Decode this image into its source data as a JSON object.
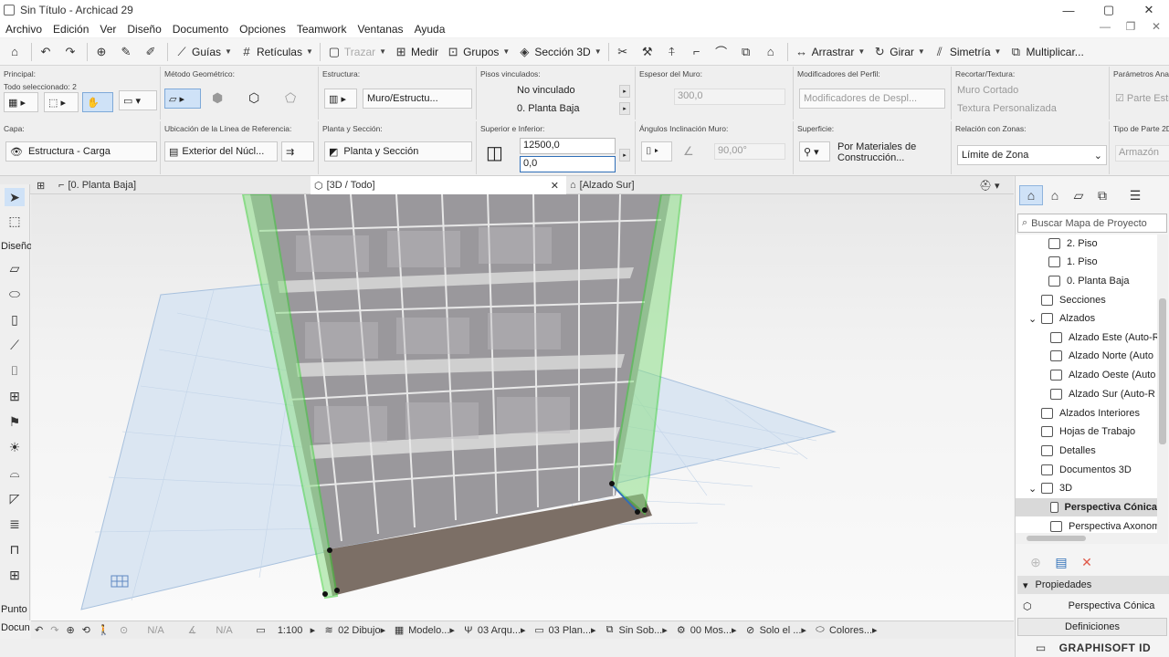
{
  "window": {
    "title": "Sin Título - Archicad 29",
    "min": "—",
    "max": "▢",
    "close": "✕"
  },
  "menu": {
    "items": [
      "Archivo",
      "Edición",
      "Ver",
      "Diseño",
      "Documento",
      "Opciones",
      "Teamwork",
      "Ventanas",
      "Ayuda"
    ]
  },
  "toolbar": {
    "guias": "Guías",
    "reticulas": "Retículas",
    "trazar": "Trazar",
    "medir": "Medir",
    "grupos": "Grupos",
    "seccion3d": "Sección 3D",
    "arrastrar": "Arrastrar",
    "girar": "Girar",
    "simetria": "Simetría",
    "multiplicar": "Multiplicar..."
  },
  "info": {
    "principal_label": "Principal:",
    "todo_sel": "Todo seleccionado: 2",
    "metodo_label": "Método Geométrico:",
    "estructura_label": "Estructura:",
    "estructura_value": "Muro/Estructu...",
    "pisos_label": "Pisos vinculados:",
    "no_vinculado": "No vinculado",
    "planta_baja": "0. Planta Baja",
    "espesor_label": "Espesor del Muro:",
    "espesor_value": "300,0",
    "modificadores_label": "Modificadores del Perfil:",
    "modificadores_value": "Modificadores de Despl...",
    "recortar_label": "Recortar/Textura:",
    "muro_cortado": "Muro Cortado",
    "textura": "Textura Personalizada",
    "param_label": "Parámetros Ana",
    "parte_est": "Parte Estr",
    "capa_label": "Capa:",
    "capa_value": "Estructura - Carga",
    "ubicacion_label": "Ubicación de la Línea de Referencia:",
    "ubicacion_value": "Exterior del Núcl...",
    "planta_label": "Planta y Sección:",
    "planta_value": "Planta y Sección",
    "superior_label": "Superior e Inferior:",
    "superior_value": "12500,0",
    "inferior_value": "0,0",
    "angulos_label": "Ángulos Inclinación Muro:",
    "angulo_value": "90,00°",
    "superficie_label": "Superficie:",
    "superficie_value": "Por Materiales de Construcción...",
    "relacion_label": "Relación con Zonas:",
    "relacion_value": "Límite de Zona",
    "tipo_label": "Tipo de Parte 2D",
    "tipo_value": "Armazón"
  },
  "tabs": [
    "[0. Planta Baja]",
    "[3D / Todo]",
    "[Alzado Sur]"
  ],
  "lefttool": {
    "diseno": "Diseño",
    "punto": "Punto",
    "docu": "Docun"
  },
  "status": {
    "na1": "N/A",
    "na2": "N/A",
    "scale": "1:100",
    "dibujo": "02 Dibujo",
    "modelo": "Modelo...",
    "arqu": "03 Arqu...",
    "plan": "03 Plan...",
    "sinsob": "Sin Sob...",
    "mos": "00 Mos...",
    "soloel": "Solo el ...",
    "colores": "Colores..."
  },
  "navigator": {
    "search_placeholder": "Buscar Mapa de Proyecto",
    "items": [
      "2. Piso",
      "1. Piso",
      "0. Planta Baja",
      "Secciones",
      "Alzados",
      "Alzado Este (Auto-R",
      "Alzado Norte (Auto",
      "Alzado Oeste (Auto",
      "Alzado Sur (Auto-R",
      "Alzados Interiores",
      "Hojas de Trabajo",
      "Detalles",
      "Documentos 3D",
      "3D",
      "Perspectiva Cónica",
      "Perspectiva Axonom"
    ],
    "propiedades": "Propiedades",
    "prop_value": "Perspectiva Cónica",
    "definiciones": "Definiciones",
    "brand": "GRAPHISOFT ID"
  },
  "colors": {
    "accent": "#2f6fb8",
    "selection_green": "#3fd13a"
  }
}
